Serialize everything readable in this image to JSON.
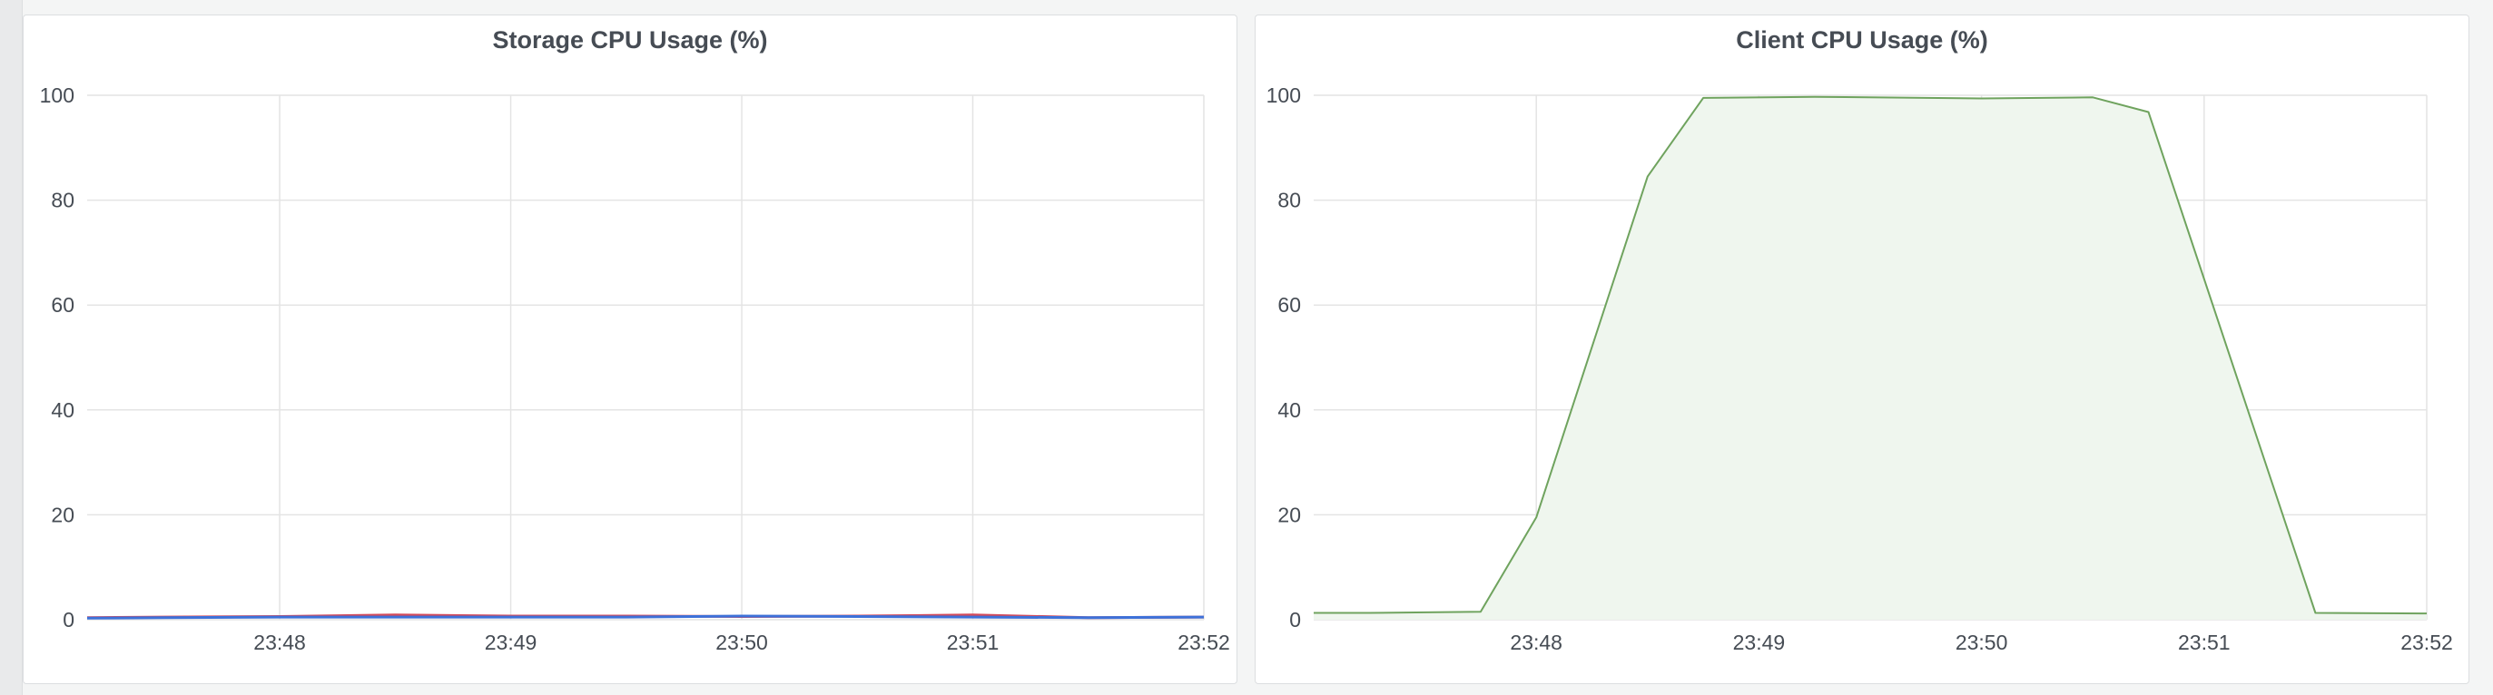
{
  "colors": {
    "storage_red": "#d44a5a",
    "storage_blue": "#3d71d9",
    "client_green": "#6fa35e",
    "client_fill": "#eff6ee",
    "grid": "#e4e4e4",
    "text": "#464c54"
  },
  "chart_data": [
    {
      "type": "line",
      "title": "Storage CPU Usage (%)",
      "xlabel": "",
      "ylabel": "",
      "ylim": [
        0,
        100
      ],
      "yticks": [
        "0",
        "20",
        "40",
        "60",
        "80",
        "100"
      ],
      "xticks": [
        "23:48",
        "23:49",
        "23:50",
        "23:51",
        "23:52"
      ],
      "grid": true,
      "series": [
        {
          "color": "#d44a5a",
          "x": [
            "23:47:10",
            "23:47:30",
            "23:48:00",
            "23:48:30",
            "23:49:00",
            "23:49:30",
            "23:50:00",
            "23:50:30",
            "23:51:00",
            "23:51:30",
            "23:52:00"
          ],
          "values": [
            0.4,
            0.5,
            0.6,
            0.9,
            0.7,
            0.7,
            0.6,
            0.7,
            0.9,
            0.4,
            0.5
          ]
        },
        {
          "color": "#3d71d9",
          "x": [
            "23:47:10",
            "23:47:30",
            "23:48:00",
            "23:48:30",
            "23:49:00",
            "23:49:30",
            "23:50:00",
            "23:50:30",
            "23:51:00",
            "23:51:30",
            "23:52:00"
          ],
          "values": [
            0.3,
            0.4,
            0.5,
            0.5,
            0.5,
            0.5,
            0.7,
            0.6,
            0.5,
            0.4,
            0.5
          ]
        }
      ]
    },
    {
      "type": "area",
      "title": "Client CPU Usage (%)",
      "xlabel": "",
      "ylabel": "",
      "ylim": [
        0,
        100
      ],
      "yticks": [
        "0",
        "20",
        "40",
        "60",
        "80",
        "100"
      ],
      "xticks": [
        "23:48",
        "23:49",
        "23:50",
        "23:51",
        "23:52"
      ],
      "grid": true,
      "series": [
        {
          "color": "#6fa35e",
          "x": [
            "23:47:00",
            "23:47:15",
            "23:47:45",
            "23:48:00",
            "23:48:30",
            "23:48:45",
            "23:49:15",
            "23:50:00",
            "23:50:30",
            "23:50:45",
            "23:51:30",
            "23:52:00"
          ],
          "values": [
            1.3,
            1.3,
            1.5,
            19.5,
            84.5,
            99.5,
            99.7,
            99.4,
            99.6,
            96.8,
            1.3,
            1.2
          ]
        }
      ]
    }
  ]
}
